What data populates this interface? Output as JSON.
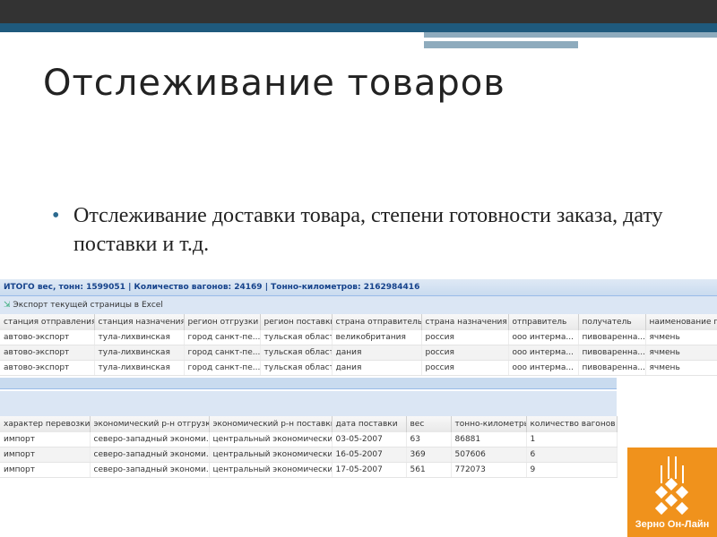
{
  "slide": {
    "title": "Отслеживание товаров",
    "bullet": "Отслеживание доставки товара, степени готовности заказа, дату поставки и т.д."
  },
  "grid1": {
    "summary": "ИТОГО вес, тонн: 1599051 | Количество вагонов: 24169 | Тонно-километров: 2162984416",
    "export": "Экспорт текущей страницы в Excel",
    "columns": [
      "станция отправления",
      "станция назначения",
      "регион отгрузки",
      "регион поставки",
      "страна отправитель",
      "страна назначения",
      "отправитель",
      "получатель",
      "наименование груза"
    ],
    "rows": [
      [
        "автово-экспорт",
        "тула-лихвинская",
        "город санкт-пе...",
        "тульская область",
        "великобритания",
        "россия",
        "ооо интерма...",
        "пивоваренна...",
        "ячмень"
      ],
      [
        "автово-экспорт",
        "тула-лихвинская",
        "город санкт-пе...",
        "тульская область",
        "дания",
        "россия",
        "ооо интерма...",
        "пивоваренна...",
        "ячмень"
      ],
      [
        "автово-экспорт",
        "тула-лихвинская",
        "город санкт-пе...",
        "тульская область",
        "дания",
        "россия",
        "ооо интерма...",
        "пивоваренна...",
        "ячмень"
      ]
    ]
  },
  "grid2": {
    "columns": [
      "характер перевозки",
      "экономический р-н отгрузки",
      "экономический р-н поставки",
      "дата поставки",
      "вес",
      "тонно-километры",
      "количество вагонов"
    ],
    "rows": [
      [
        "импорт",
        "северо-западный экономи...",
        "центральный экономически...",
        "03-05-2007",
        "63",
        "86881",
        "1"
      ],
      [
        "импорт",
        "северо-западный экономи...",
        "центральный экономически...",
        "16-05-2007",
        "369",
        "507606",
        "6"
      ],
      [
        "импорт",
        "северо-западный экономи...",
        "центральный экономически...",
        "17-05-2007",
        "561",
        "772073",
        "9"
      ]
    ]
  },
  "logo": {
    "text": "Зерно Он-Лайн"
  }
}
